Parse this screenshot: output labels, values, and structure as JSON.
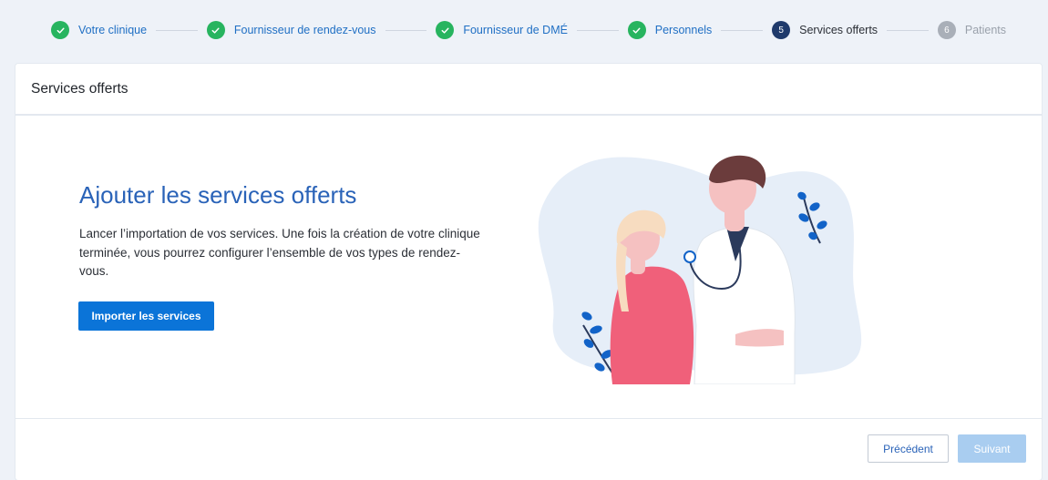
{
  "stepper": {
    "steps": [
      {
        "number": "1",
        "label": "Votre clinique",
        "state": "done"
      },
      {
        "number": "2",
        "label": "Fournisseur de rendez-vous",
        "state": "done"
      },
      {
        "number": "3",
        "label": "Fournisseur de DMÉ",
        "state": "done"
      },
      {
        "number": "4",
        "label": "Personnels",
        "state": "done"
      },
      {
        "number": "5",
        "label": "Services offerts",
        "state": "current"
      },
      {
        "number": "6",
        "label": "Patients",
        "state": "pending"
      }
    ]
  },
  "card": {
    "title": "Services offerts",
    "hero_title": "Ajouter les services offerts",
    "hero_text": "Lancer l’importation de vos services. Une fois la création de votre clinique terminée, vous pourrez configurer l’ensemble de vos types de rendez-vous.",
    "import_button": "Importer les services",
    "illustration_icon": "doctor-patient-illustration"
  },
  "footer": {
    "previous_button": "Précédent",
    "next_button": "Suivant"
  },
  "colors": {
    "accent": "#0b74d8",
    "heading": "#2a63b8",
    "done": "#27b45f",
    "current": "#1f3a6b",
    "pending": "#a9afb8",
    "disabled_button": "#a9cdf0"
  }
}
